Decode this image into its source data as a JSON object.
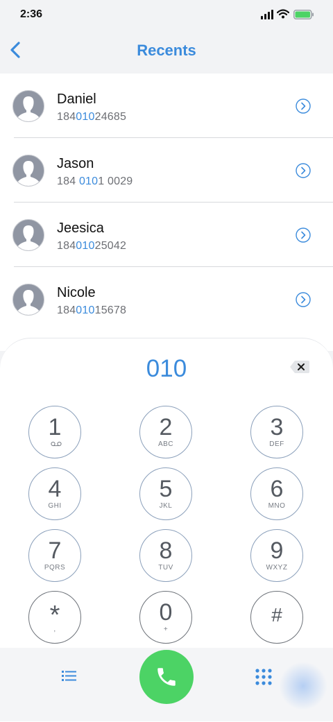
{
  "status_bar": {
    "time": "2:36"
  },
  "header": {
    "title": "Recents"
  },
  "recents": [
    {
      "name": "Daniel",
      "number_parts": [
        "184",
        "010",
        "24685"
      ]
    },
    {
      "name": "Jason",
      "number_parts": [
        "184 ",
        "010",
        "1 0029"
      ]
    },
    {
      "name": "Jeesica",
      "number_parts": [
        "184",
        "010",
        "25042"
      ]
    },
    {
      "name": "Nicole",
      "number_parts": [
        "184",
        "010",
        "15678"
      ]
    }
  ],
  "dialer": {
    "input": "010",
    "keys": [
      {
        "digit": "1",
        "letters": ""
      },
      {
        "digit": "2",
        "letters": "ABC"
      },
      {
        "digit": "3",
        "letters": "DEF"
      },
      {
        "digit": "4",
        "letters": "GHI"
      },
      {
        "digit": "5",
        "letters": "JKL"
      },
      {
        "digit": "6",
        "letters": "MNO"
      },
      {
        "digit": "7",
        "letters": "PQRS"
      },
      {
        "digit": "8",
        "letters": "TUV"
      },
      {
        "digit": "9",
        "letters": "WXYZ"
      },
      {
        "digit": "*",
        "letters": ","
      },
      {
        "digit": "0",
        "letters": "+"
      },
      {
        "digit": "#",
        "letters": ""
      }
    ]
  },
  "colors": {
    "accent": "#3b8bdc",
    "call": "#4cd365"
  },
  "icons": {
    "back": "chevron-left-icon",
    "info": "chevron-right-circle-icon",
    "delete": "backspace-icon",
    "list": "list-icon",
    "call": "phone-icon",
    "keypad": "keypad-grid-icon"
  }
}
